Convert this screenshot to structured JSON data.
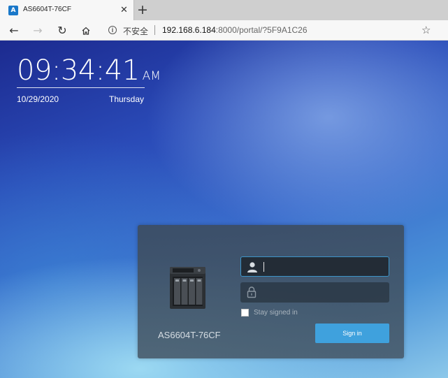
{
  "browser": {
    "tab_title": "AS6604T-76CF",
    "favicon_letter": "A",
    "tab_close": "✕",
    "new_tab": "+",
    "security_text": "不安全",
    "url_host": "192.168.6.184",
    "url_rest": ":8000/portal/?5F9A1C26"
  },
  "clock": {
    "hours_minutes": "09:34:",
    "seconds": "41",
    "ampm": "AM",
    "date": "10/29/2020",
    "weekday": "Thursday"
  },
  "login": {
    "device_name": "AS6604T-76CF",
    "username_value": "",
    "password_value": "",
    "stay_signed_in_label": "Stay signed in",
    "stay_signed_in_checked": false,
    "signin_label": "Sign in"
  },
  "colors": {
    "accent": "#3fa1dd",
    "focus_border": "#3d94c8",
    "panel": "#3c4b5c"
  },
  "icons": {
    "user": "user-icon",
    "lock": "lock-icon",
    "back": "back-arrow-icon",
    "forward": "forward-arrow-icon",
    "refresh": "refresh-icon",
    "home": "home-icon",
    "info": "info-icon",
    "favorite": "star-icon"
  }
}
